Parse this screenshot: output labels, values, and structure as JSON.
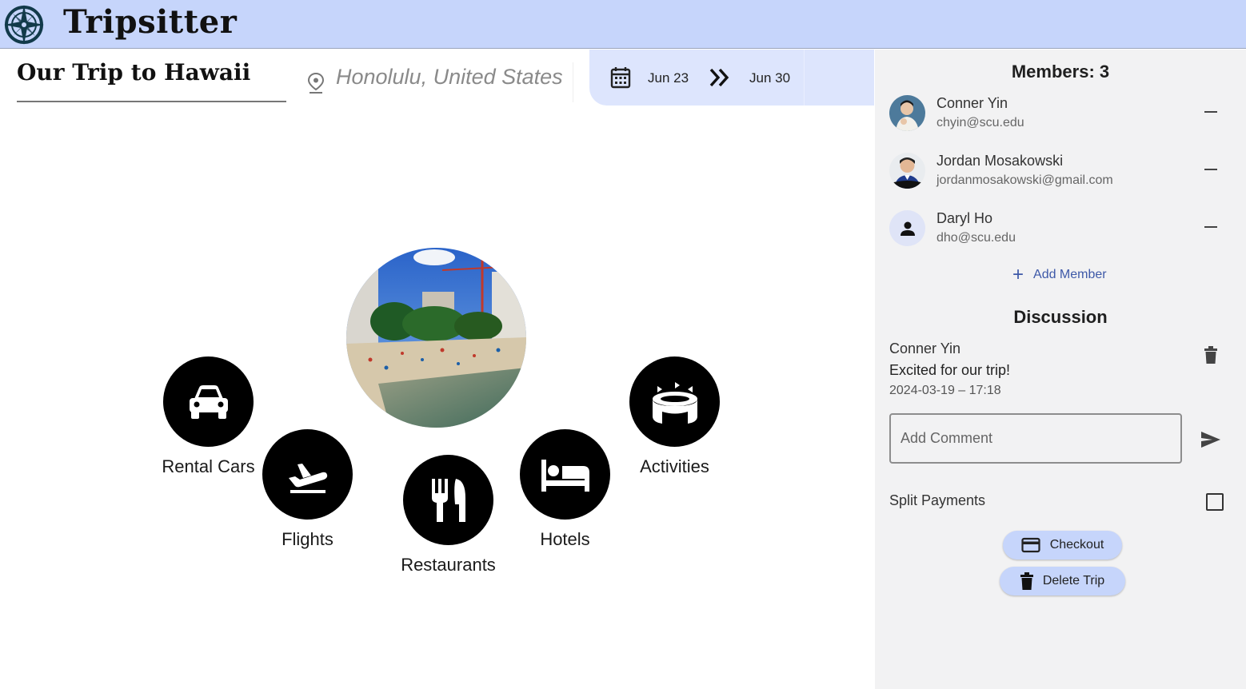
{
  "app": {
    "title": "Tripsitter"
  },
  "trip": {
    "name": "Our Trip to Hawaii",
    "location": "Honolulu, United States",
    "start_date": "Jun 23",
    "end_date": "Jun 30"
  },
  "categories": [
    {
      "label": "Rental Cars",
      "icon": "car-icon"
    },
    {
      "label": "Flights",
      "icon": "flight-takeoff-icon"
    },
    {
      "label": "Restaurants",
      "icon": "restaurant-icon"
    },
    {
      "label": "Hotels",
      "icon": "hotel-bed-icon"
    },
    {
      "label": "Activities",
      "icon": "stadium-icon"
    }
  ],
  "sidebar": {
    "members_title": "Members: 3",
    "members": [
      {
        "name": "Conner Yin",
        "email": "chyin@scu.edu"
      },
      {
        "name": "Jordan Mosakowski",
        "email": "jordanmosakowski@gmail.com"
      },
      {
        "name": "Daryl Ho",
        "email": "dho@scu.edu"
      }
    ],
    "add_member_label": "Add Member",
    "discussion_title": "Discussion",
    "comments": [
      {
        "author": "Conner Yin",
        "text": "Excited for our trip!",
        "time": "2024-03-19 – 17:18"
      }
    ],
    "comment_placeholder": "Add Comment",
    "split_payments_label": "Split Payments",
    "split_payments_checked": false,
    "checkout_label": "Checkout",
    "delete_trip_label": "Delete Trip"
  },
  "colors": {
    "appbar": "#c6d5fb",
    "date_bar": "#dde5fd",
    "sidebar": "#f2f2f3",
    "accent": "#3e59a8",
    "logo": "#123a4a"
  }
}
